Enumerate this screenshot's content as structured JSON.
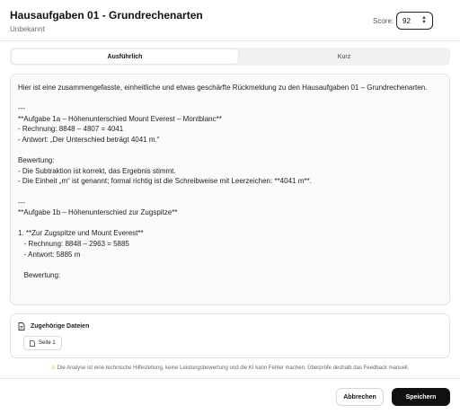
{
  "header": {
    "title": "Hausaufgaben 01 - Grundrechenarten",
    "subtitle": "Unbekannt",
    "score_label": "Score:",
    "score_value": "92"
  },
  "tabs": [
    {
      "label": "Ausführlich",
      "active": true
    },
    {
      "label": "Kurz",
      "active": false
    }
  ],
  "feedback_text": "Hier ist eine zusammengefasste, einheitliche und etwas geschärfte Rückmeldung zu den Hausaufgaben 01 – Grundrechenarten.\n\n---\n**Aufgabe 1a – Höhenunterschied Mount Everest – Montblanc**\n- Rechnung: 8848 – 4807 = 4041\n- Antwort: „Der Unterschied beträgt 4041 m.“\n\nBewertung:\n- Die Subtraktion ist korrekt, das Ergebnis stimmt.\n- Die Einheit „m“ ist genannt; formal richtig ist die Schreibweise mit Leerzeichen: **4041 m**.\n\n---\n**Aufgabe 1b – Höhenunterschied zur Zugspitze**\n\n1. **Zur Zugspitze und Mount Everest**\n   - Rechnung: 8848 – 2963 = 5885\n   - Antwort: 5885 m\n\n   Bewertung:",
  "files": {
    "title": "Zugehörige Dateien",
    "items": [
      "Seite 1"
    ]
  },
  "disclaimer": "Die Analyse ist eine technische Hilfestellung, keine Leistungsbewertung und die KI kann Fehler machen. Überprüfe deshalb das Feedback manuell.",
  "footer": {
    "cancel_label": "Abbrechen",
    "save_label": "Speichern"
  },
  "colors": {
    "primary_button": "#111111",
    "warning": "#e0a800"
  },
  "icons": {
    "files": "document-icon",
    "file_chip": "document-icon",
    "stepper": "chevron-up-down-icon",
    "disclaimer": "warning-icon"
  }
}
